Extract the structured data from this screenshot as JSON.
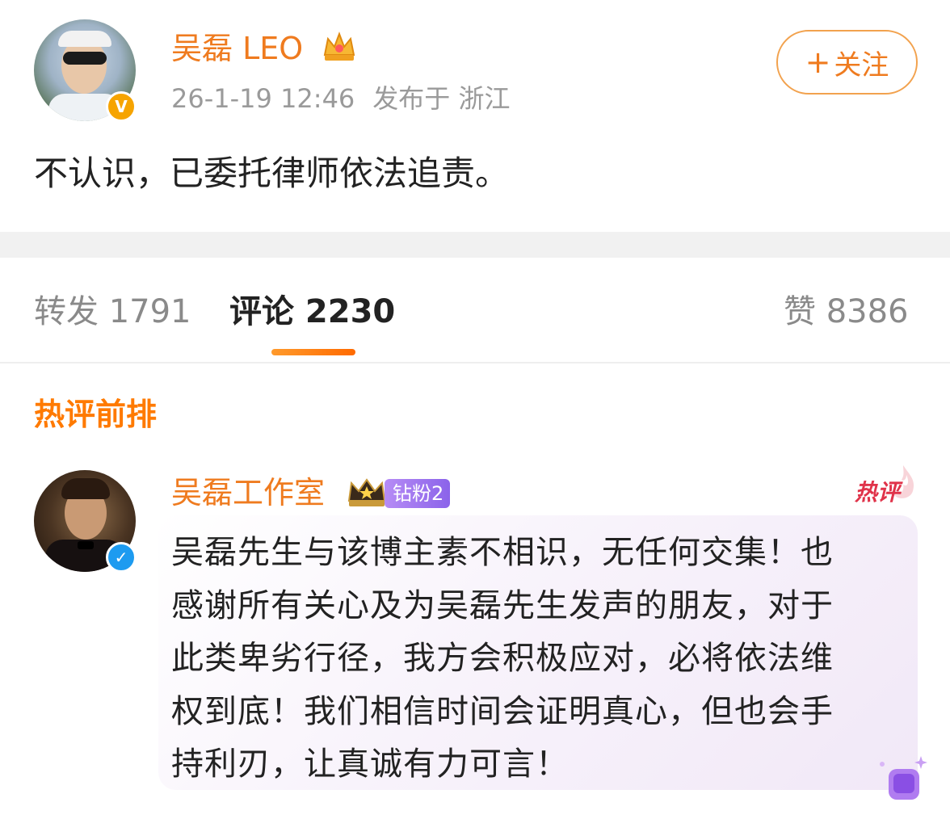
{
  "post": {
    "author": "吴磊 LEO",
    "timestamp": "26-1-19 12:46",
    "location": "发布于 浙江",
    "follow_label": "关注",
    "follow_plus": "+",
    "text": "不认识，已委托律师依法追责。",
    "verify_mark": "V"
  },
  "tabs": {
    "repost": "转发 1791",
    "comments": "评论 2230",
    "likes": "赞 8386"
  },
  "hot_section": {
    "title": "热评前排"
  },
  "comment": {
    "author": "吴磊工作室",
    "fan_badge": "钻粉2",
    "hot_tag": "热评",
    "verify_mark": "✓",
    "lines": [
      "吴磊先生与该博主素不相识，无任何交集！也",
      "感谢所有关心及为吴磊先生发声的朋友，对于",
      "此类卑劣行径，我方会积极应对，必将依法维",
      "权到底！我们相信时间会证明真心，但也会手",
      "持利刃，让真诚有力可言！"
    ]
  },
  "colors": {
    "accent_orange": "#ef7b1f",
    "hot_red": "#e0334a",
    "fan_purple": "#8b63ea"
  }
}
